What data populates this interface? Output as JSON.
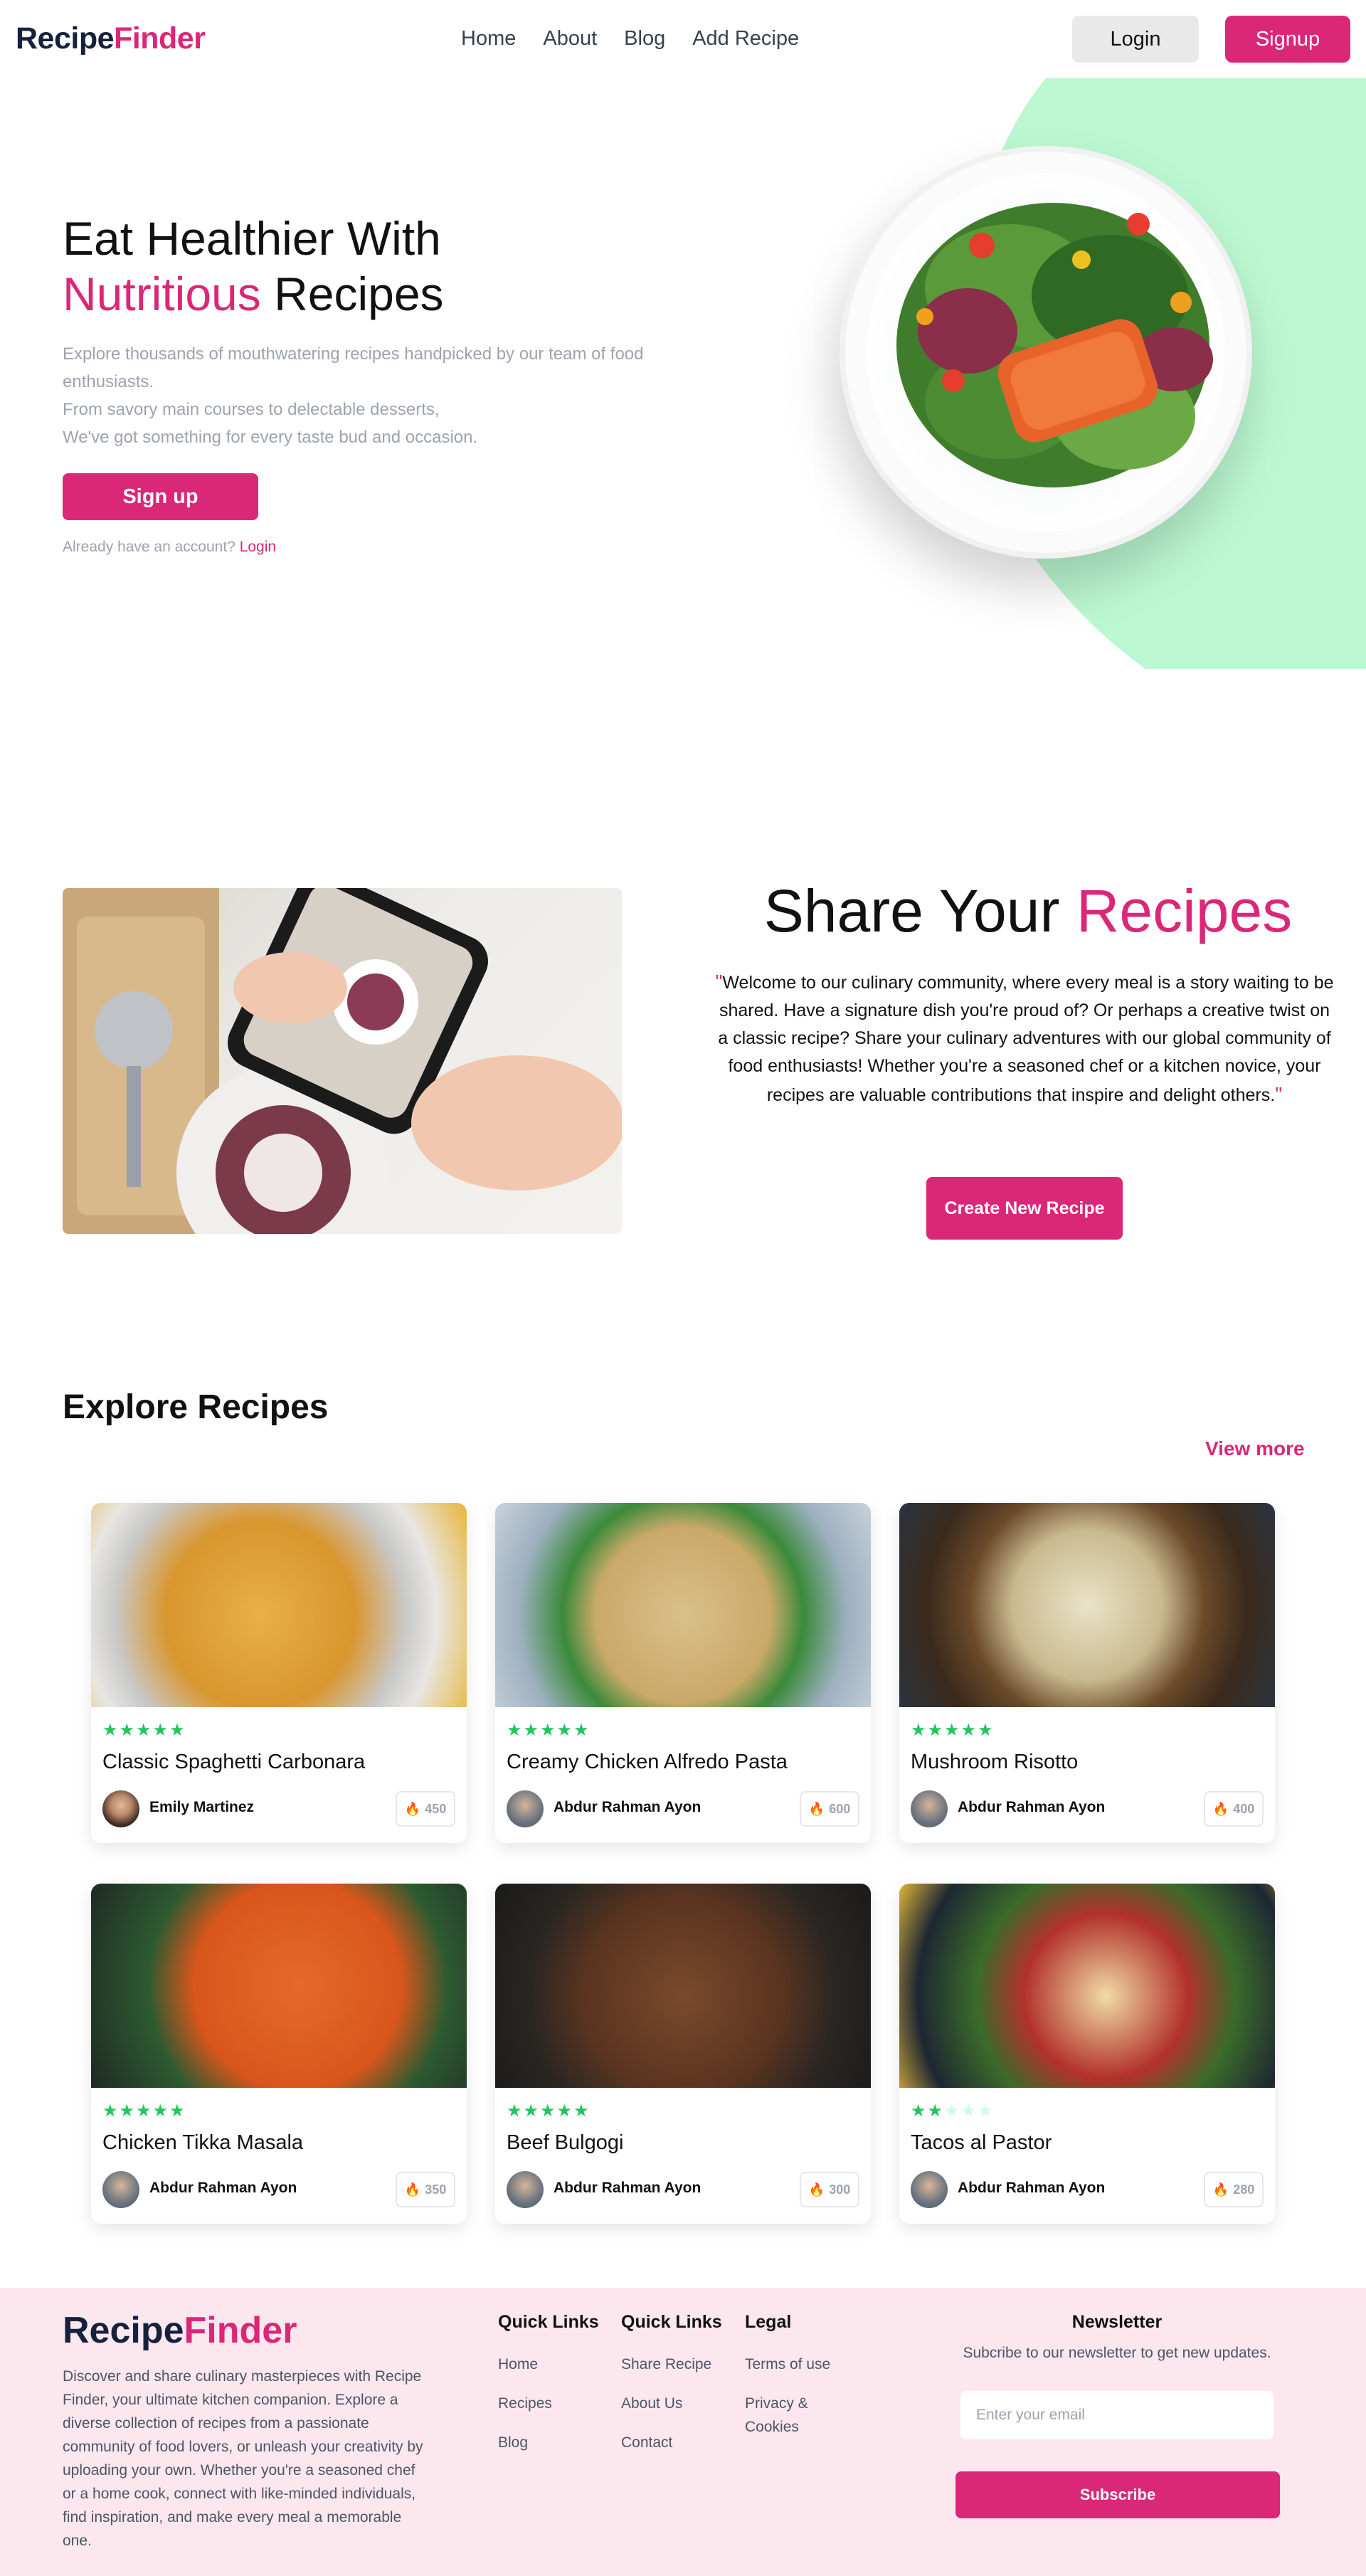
{
  "nav": {
    "logo_part1": "Recipe",
    "logo_part2": "Finder",
    "links": [
      "Home",
      "About",
      "Blog",
      "Add Recipe"
    ],
    "login": "Login",
    "signup": "Signup"
  },
  "hero": {
    "title_line1": "Eat Healthier With",
    "title_pink": "Nutritious",
    "title_rest": " Recipes",
    "desc_line1": "Explore thousands of mouthwatering recipes handpicked by our team of food enthusiasts.",
    "desc_line2": "From savory main courses to delectable desserts,",
    "desc_line3": "We've got something for every taste bud and occasion.",
    "signup_button": "Sign up",
    "account_text": "Already have an account?",
    "account_link": "Login"
  },
  "share": {
    "title_part1": "Share Your ",
    "title_pink": "Recipes",
    "quote_open": "\"",
    "quote_close": "\"",
    "text": "Welcome to our culinary community, where every meal is a story waiting to be shared. Have a signature dish you're proud of? Or perhaps a creative twist on a classic recipe? Share your culinary adventures with our global community of food enthusiasts! Whether you're a seasoned chef or a kitchen novice, your recipes are valuable contributions that inspire and delight others.",
    "button": "Create New Recipe"
  },
  "explore": {
    "title": "Explore Recipes",
    "view_more": "View more",
    "cards": [
      {
        "title": "Classic Spaghetti Carbonara",
        "author": "Emily Martinez",
        "calories": "450",
        "rating": 5
      },
      {
        "title": "Creamy Chicken Alfredo Pasta",
        "author": "Abdur Rahman Ayon",
        "calories": "600",
        "rating": 5
      },
      {
        "title": "Mushroom Risotto",
        "author": "Abdur Rahman Ayon",
        "calories": "400",
        "rating": 5
      },
      {
        "title": "Chicken Tikka Masala",
        "author": "Abdur Rahman Ayon",
        "calories": "350",
        "rating": 5
      },
      {
        "title": "Beef Bulgogi",
        "author": "Abdur Rahman Ayon",
        "calories": "300",
        "rating": 5
      },
      {
        "title": "Tacos al Pastor",
        "author": "Abdur Rahman Ayon",
        "calories": "280",
        "rating": 2
      }
    ]
  },
  "footer": {
    "logo_part1": "Recipe",
    "logo_part2": "Finder",
    "desc": "Discover and share culinary masterpieces with Recipe Finder, your ultimate kitchen companion. Explore a diverse collection of recipes from a passionate community of food lovers, or unleash your creativity by uploading your own. Whether you're a seasoned chef or a home cook, connect with like-minded individuals, find inspiration, and make every meal a memorable one.",
    "col1": {
      "title": "Quick Links",
      "links": [
        "Home",
        "Recipes",
        "Blog"
      ]
    },
    "col2": {
      "title": "Quick Links",
      "links": [
        "Share Recipe",
        "About Us",
        "Contact"
      ]
    },
    "col3": {
      "title": "Legal",
      "links": [
        "Terms of use",
        "Privacy & Cookies"
      ]
    },
    "newsletter_title": "Newsletter",
    "newsletter_sub": "Subcribe to our newsletter to get new updates.",
    "email_placeholder": "Enter your email",
    "subscribe": "Subscribe"
  },
  "colors": {
    "accent": "#db2777",
    "green": "#bbf7d0",
    "star": "#22c55e",
    "footer_bg": "#fde7ef"
  }
}
